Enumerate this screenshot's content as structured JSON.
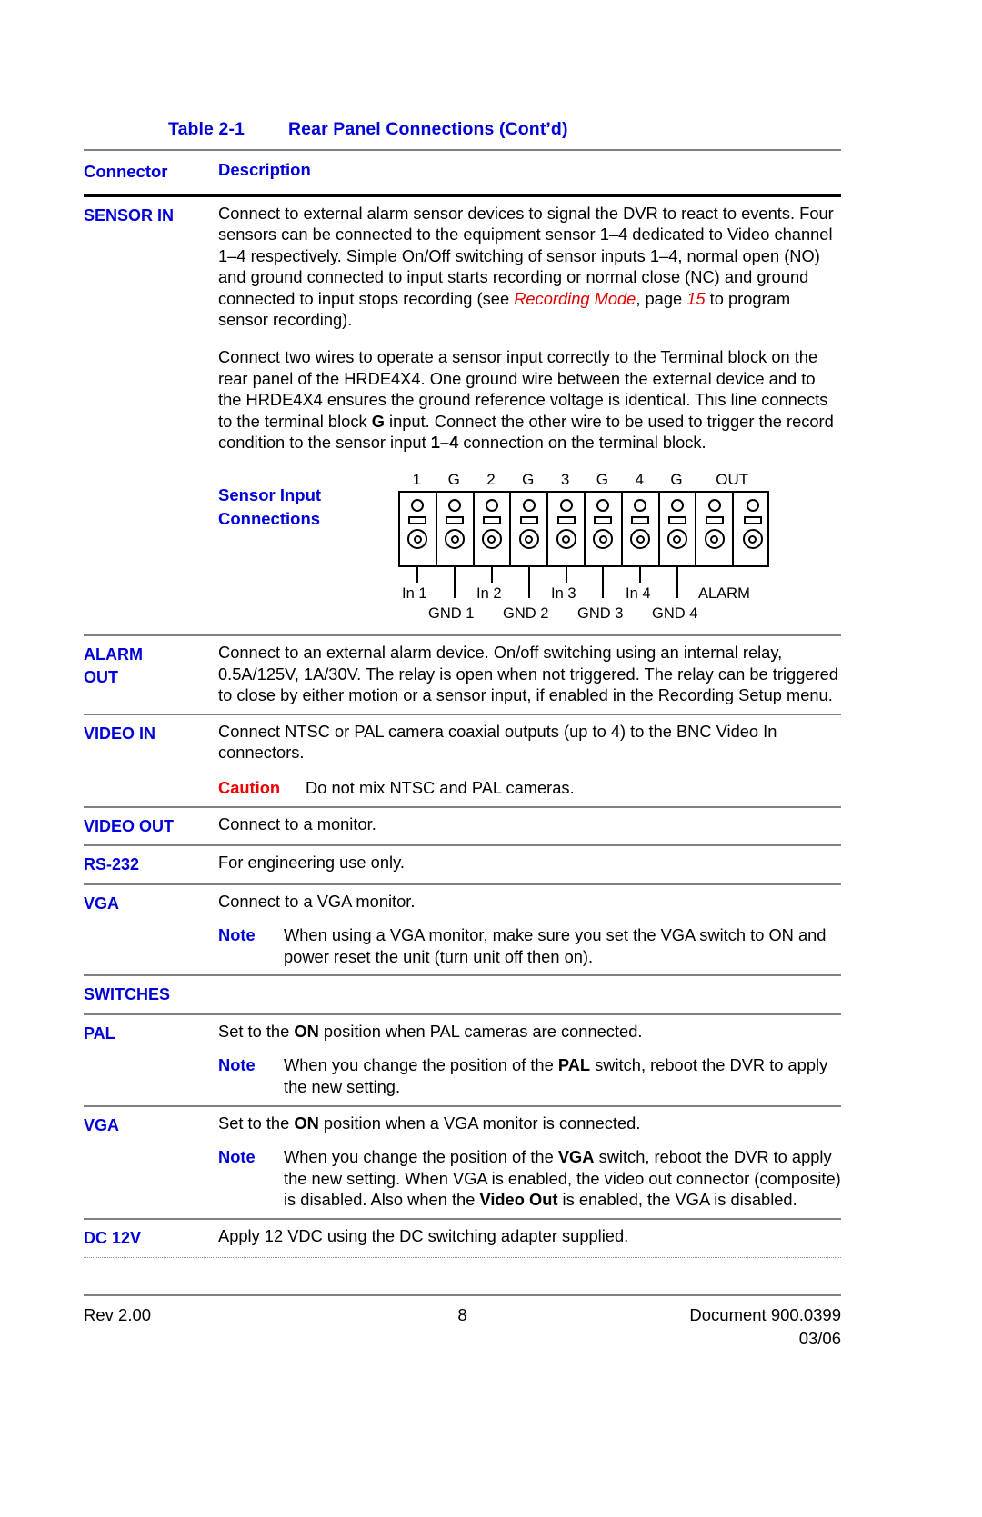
{
  "document": {
    "table_title_number": "Table 2-1",
    "table_title_text": "Rear Panel Connections  (Cont’d)",
    "header": {
      "connector": "Connector",
      "description": "Description"
    },
    "colors": {
      "heading_blue": "#0000d8",
      "caution_red": "#f00000",
      "italic_red": "#e00000",
      "rule_gray": "#808080"
    }
  },
  "rows": {
    "sensor_in": {
      "connector": "SENSOR IN",
      "para1_a": "Connect to external alarm sensor devices to signal the DVR to react to events. Four sensors can be connected to the equipment sensor 1–4 dedicated to Video channel 1–4 respectively. Simple On/Off switching of sensor inputs 1–4, normal open (NO) and ground connected to input starts recording or normal close (NC) and ground connected to input stops recording (see ",
      "para1_italic_ref": "Recording Mode",
      "para1_b": ", page ",
      "para1_page": "15",
      "para1_c": " to program sensor recording).",
      "para2_a": "Connect two wires to operate a sensor input correctly to the Terminal block on the rear panel of the HRDE4X4. One ground wire between the external device and to the HRDE4X4 ensures the ground reference voltage is identical. This line connects to the terminal block ",
      "para2_bold_g": "G",
      "para2_b": " input. Connect the other wire to be used to trigger the record condition to the sensor input ",
      "para2_bold_range": "1–4",
      "para2_c": " connection on the terminal block."
    },
    "sensor_diagram": {
      "label_line1": "Sensor Input",
      "label_line2": "Connections",
      "top_labels": [
        "1",
        "G",
        "2",
        "G",
        "3",
        "G",
        "4",
        "G",
        "OUT"
      ],
      "bottom_labels_in": [
        "In 1",
        "In 2",
        "In 3",
        "In 4"
      ],
      "bottom_label_alarm": "ALARM",
      "bottom_labels_gnd": [
        "GND 1",
        "GND 2",
        "GND 3",
        "GND 4"
      ],
      "terminal_count": 10
    },
    "alarm_out": {
      "connector_line1": "ALARM",
      "connector_line2": "OUT",
      "description": "Connect to an external alarm device. On/off switching using an internal relay, 0.5A/125V, 1A/30V. The relay is open when not triggered. The relay can be triggered to close by either motion or a sensor input, if enabled in the Recording Setup menu."
    },
    "video_in": {
      "connector": "VIDEO IN",
      "description": "Connect NTSC or PAL camera coaxial outputs (up to 4) to the BNC Video In connectors.",
      "caution_label": "Caution",
      "caution_text": "Do not mix NTSC and PAL cameras."
    },
    "video_out": {
      "connector": "VIDEO OUT",
      "description": "Connect to a monitor."
    },
    "rs232": {
      "connector": "RS-232",
      "description": "For engineering use only."
    },
    "vga_connector": {
      "connector": "VGA",
      "description": "Connect to a VGA monitor.",
      "note_label": "Note",
      "note_text": "When using a VGA monitor, make sure you set the VGA switch to ON and power reset the unit (turn unit off then on)."
    },
    "switches": {
      "connector": "SWITCHES",
      "description": ""
    },
    "pal": {
      "connector": "PAL",
      "desc_a": "Set to the ",
      "desc_bold": "ON",
      "desc_b": " position when PAL cameras are connected.",
      "note_label": "Note",
      "note_a": "When you change the position of the ",
      "note_bold": "PAL",
      "note_b": " switch, reboot the DVR to apply the new setting."
    },
    "vga_switch": {
      "connector": "VGA",
      "desc_a": "Set to the ",
      "desc_bold": "ON",
      "desc_b": " position when a VGA monitor is connected.",
      "note_label": "Note",
      "note_a": "When you change the position of the ",
      "note_bold1": "VGA",
      "note_b": " switch, reboot the DVR to apply the new setting. When VGA is enabled, the video out connector (composite) is disabled. Also when the ",
      "note_bold2": "Video Out",
      "note_c": " is enabled, the VGA is disabled."
    },
    "dc12v": {
      "connector": "DC 12V",
      "description": "Apply 12 VDC using the DC switching adapter supplied."
    }
  },
  "footer": {
    "left": "Rev 2.00",
    "page_number": "8",
    "right_line1": "Document 900.0399",
    "right_line2": "03/06"
  }
}
